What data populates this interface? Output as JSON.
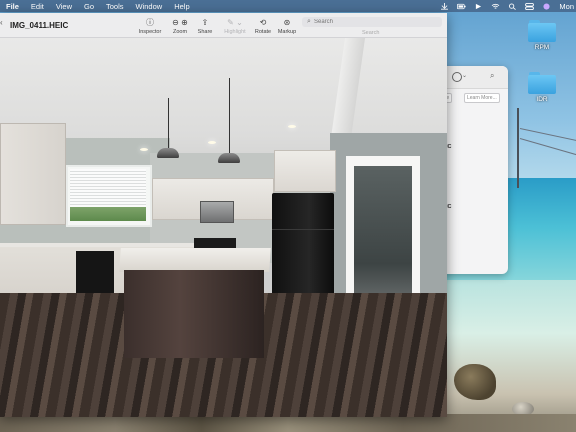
{
  "menubar": {
    "app_name": "File",
    "items": [
      "Edit",
      "View",
      "Go",
      "Tools",
      "Window",
      "Help"
    ],
    "clock": "Mon"
  },
  "desktop": {
    "icons": [
      {
        "name": "folder-icon",
        "label": "RPM"
      },
      {
        "name": "folder-icon",
        "label": "IDR"
      }
    ]
  },
  "background_window": {
    "pill_left": "te",
    "pill_right": "Learn More...",
    "row_labels": [
      "IC",
      "IC"
    ]
  },
  "preview": {
    "chevron": "‹",
    "filename": "IMG_0411.HEIC",
    "toolbar": {
      "inspector": "Inspector",
      "zoom": "Zoom",
      "share": "Share",
      "highlight": "Highlight",
      "rotate": "Rotate",
      "markup": "Markup",
      "search_label": "Search"
    },
    "search": {
      "placeholder": "Search"
    }
  },
  "colors": {
    "menubar": "#4a6f95",
    "folder": "#4fb2ee"
  }
}
